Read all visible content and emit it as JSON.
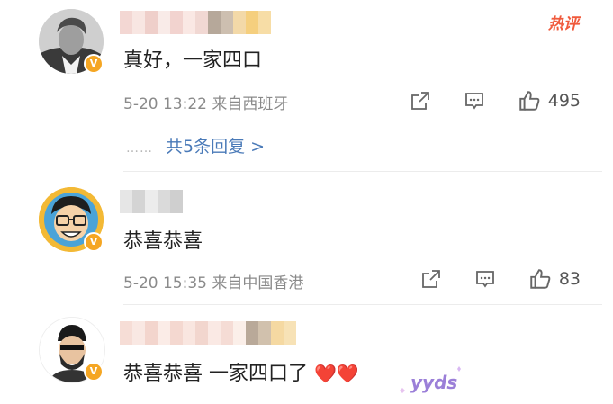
{
  "hot_label": "热评",
  "comments": [
    {
      "text": "真好，一家四口",
      "meta": "5-20 13:22  来自西班牙",
      "likes": "495",
      "replies_label": "共5条回复 >",
      "replies_dots": "……"
    },
    {
      "text": "恭喜恭喜",
      "meta": "5-20 15:35  来自中国香港",
      "likes": "83"
    },
    {
      "text": "恭喜恭喜 一家四口了",
      "hearts": "❤️❤️",
      "sticker": "yyds"
    }
  ],
  "icons": {
    "share": "share-icon",
    "comment": "comment-icon",
    "like": "thumbs-up-icon",
    "verified": "verified-badge-icon"
  },
  "colors": {
    "link": "#4a7ab8",
    "meta": "#8a8a8a",
    "badge": "#f5a623",
    "hot": "#f05a3c"
  }
}
